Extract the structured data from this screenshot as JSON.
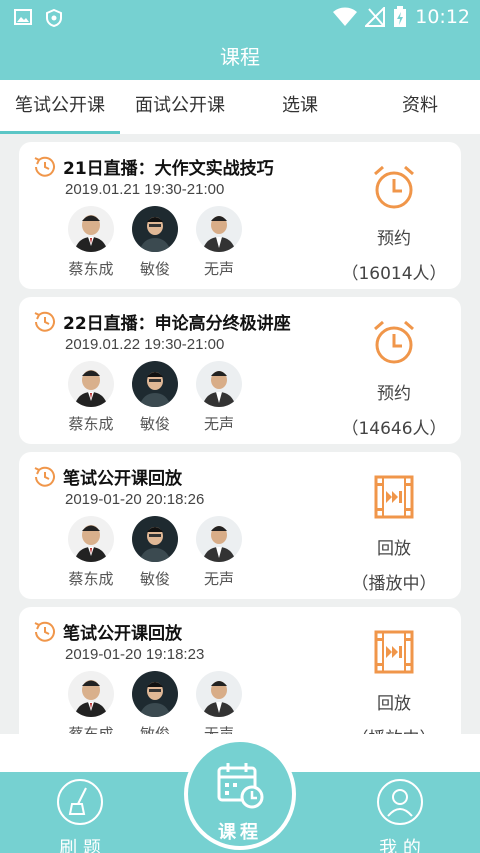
{
  "status_bar": {
    "time": "10:12"
  },
  "header": {
    "title": "课程"
  },
  "tabs": [
    {
      "label": "笔试公开课",
      "active": true
    },
    {
      "label": "面试公开课",
      "active": false
    },
    {
      "label": "选课",
      "active": false
    },
    {
      "label": "资料",
      "active": false
    }
  ],
  "cards": [
    {
      "title": "21日直播：大作文实战技巧",
      "time": "2019.01.21 19:30-21:00",
      "teachers": [
        "蔡东成",
        "敏俊",
        "无声"
      ],
      "action_label": "预约",
      "action_count": "（16014人）",
      "action_icon": "alarm-clock-icon"
    },
    {
      "title": "22日直播：申论高分终极讲座",
      "time": "2019.01.22 19:30-21:00",
      "teachers": [
        "蔡东成",
        "敏俊",
        "无声"
      ],
      "action_label": "预约",
      "action_count": "（14646人）",
      "action_icon": "alarm-clock-icon"
    },
    {
      "title": "笔试公开课回放",
      "time": "2019-01-20 20:18:26",
      "teachers": [
        "蔡东成",
        "敏俊",
        "无声"
      ],
      "action_label": "回放",
      "action_count": "（播放中）",
      "action_icon": "replay-film-icon"
    },
    {
      "title": "笔试公开课回放",
      "time": "2019-01-20 19:18:23",
      "teachers": [
        "蔡东成",
        "敏俊",
        "无声"
      ],
      "action_label": "回放",
      "action_count": "（播放中）",
      "action_icon": "replay-film-icon"
    }
  ],
  "bottom_nav": {
    "left_label": "刷 题",
    "center_label": "课程",
    "right_label": "我 的"
  },
  "colors": {
    "teal": "#76d1d1",
    "orange": "#f0964a"
  }
}
